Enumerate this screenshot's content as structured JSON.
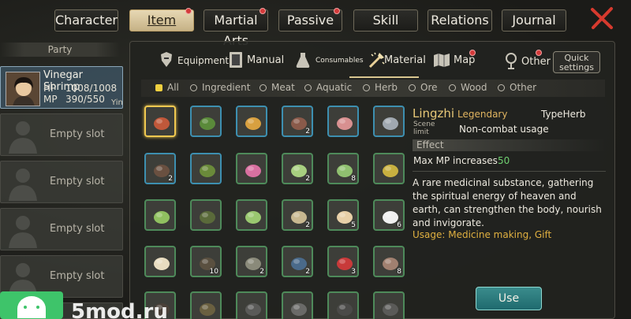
{
  "top_tabs": [
    {
      "label": "Character",
      "active": false,
      "dot": false
    },
    {
      "label": "Item",
      "active": true,
      "dot": true
    },
    {
      "label": "Martial Arts",
      "active": false,
      "dot": true
    },
    {
      "label": "Passive",
      "active": false,
      "dot": true
    },
    {
      "label": "Skill",
      "active": false,
      "dot": false
    },
    {
      "label": "Relations",
      "active": false,
      "dot": false
    },
    {
      "label": "Journal",
      "active": false,
      "dot": false
    }
  ],
  "party": {
    "header": "Party",
    "member": {
      "name": "Vinegar Shrimp",
      "hp_label": "HP",
      "hp_value": "1008/1008",
      "mp_label": "MP",
      "mp_value": "390/550",
      "suffix": "Yin"
    },
    "empty_label": "Empty slot"
  },
  "categories": [
    {
      "label": "Equipment",
      "icon": "equipment-icon"
    },
    {
      "label": "Manual",
      "icon": "manual-icon"
    },
    {
      "label": "Consumables",
      "icon": "consumables-icon"
    },
    {
      "label": "Material",
      "icon": "material-icon",
      "active": true
    },
    {
      "label": "Map",
      "icon": "map-icon"
    },
    {
      "label": "Other",
      "icon": "other-icon"
    }
  ],
  "quick_settings": "Quick settings",
  "filters": [
    {
      "label": "All",
      "active": true
    },
    {
      "label": "Ingredient"
    },
    {
      "label": "Meat"
    },
    {
      "label": "Aquatic"
    },
    {
      "label": "Herb"
    },
    {
      "label": "Ore"
    },
    {
      "label": "Wood"
    },
    {
      "label": "Other"
    }
  ],
  "items": [
    {
      "icon": "lingzhi-mushroom-icon",
      "qty": "",
      "frame": "selected"
    },
    {
      "icon": "leaf-bundle-icon",
      "qty": "",
      "frame": "blue"
    },
    {
      "icon": "bowl-icon",
      "qty": "",
      "frame": "blue"
    },
    {
      "icon": "snake-icon",
      "qty": "2",
      "frame": "blue"
    },
    {
      "icon": "meat-icon",
      "qty": "",
      "frame": "blue"
    },
    {
      "icon": "fish-icon",
      "qty": "",
      "frame": "blue"
    },
    {
      "icon": "centipede-icon",
      "qty": "2",
      "frame": "blue"
    },
    {
      "icon": "zongzi-icon",
      "qty": "",
      "frame": "blue"
    },
    {
      "icon": "lotus-icon",
      "qty": "",
      "frame": "green"
    },
    {
      "icon": "cabbage-icon",
      "qty": "2",
      "frame": "green"
    },
    {
      "icon": "bokchoy-icon",
      "qty": "8",
      "frame": "green"
    },
    {
      "icon": "herb-sprig-icon",
      "qty": "",
      "frame": "green"
    },
    {
      "icon": "scallion-icon",
      "qty": "",
      "frame": "green"
    },
    {
      "icon": "grapes-icon",
      "qty": "",
      "frame": "green"
    },
    {
      "icon": "lettuce-icon",
      "qty": "",
      "frame": "green"
    },
    {
      "icon": "beans-icon",
      "qty": "2",
      "frame": "green"
    },
    {
      "icon": "eggs-icon",
      "qty": "5",
      "frame": "green"
    },
    {
      "icon": "salt-icon",
      "qty": "6",
      "frame": "green"
    },
    {
      "icon": "flour-icon",
      "qty": "",
      "frame": "green"
    },
    {
      "icon": "vine-icon",
      "qty": "10",
      "frame": "green"
    },
    {
      "icon": "fish-small-icon",
      "qty": "2",
      "frame": "green"
    },
    {
      "icon": "pan-icon",
      "qty": "2",
      "frame": "green"
    },
    {
      "icon": "berries-icon",
      "qty": "3",
      "frame": "green"
    },
    {
      "icon": "worm-icon",
      "qty": "8",
      "frame": "green"
    },
    {
      "icon": "root-icon",
      "qty": "",
      "frame": "green"
    },
    {
      "icon": "branch-icon",
      "qty": "",
      "frame": "green"
    },
    {
      "icon": "stone-icon",
      "qty": "",
      "frame": "green"
    },
    {
      "icon": "feather-icon",
      "qty": "",
      "frame": "green"
    },
    {
      "icon": "coil-icon",
      "qty": "",
      "frame": "green"
    },
    {
      "icon": "shell-icon",
      "qty": "",
      "frame": "green"
    }
  ],
  "detail": {
    "name": "Lingzhi",
    "rarity": "Legendary",
    "type": "TypeHerb",
    "scene_label": "Scene limit",
    "scene_value": "Non-combat usage",
    "effect_title": "Effect",
    "stat_label": "Max MP increases",
    "stat_value": "50",
    "description": "A rare medicinal substance, gathering the spiritual energy of heaven and earth, can strengthen the body, nourish and invigorate.",
    "usage": "Usage: Medicine making, Gift",
    "use_button": "Use"
  },
  "watermark": "5mod.ru",
  "colors": {
    "legendary": "#e0b460",
    "stat_positive": "#6fd070",
    "accent_gold": "#f0c850",
    "frame_green": "#4e8a5a",
    "frame_blue": "#3d8fb0"
  }
}
